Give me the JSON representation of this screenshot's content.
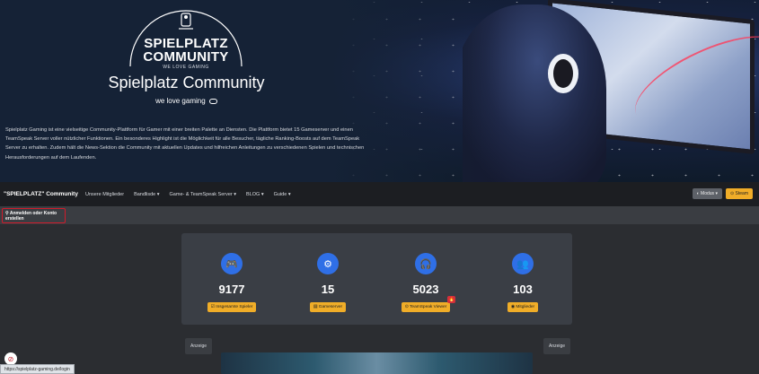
{
  "hero": {
    "logo_line1": "SPIELPLATZ",
    "logo_line2": "COMMUNITY",
    "logo_tagline": "WE LOVE GAMING",
    "title": "Spielplatz Community",
    "subtitle": "we love gaming",
    "description": "Spielplatz Gaming ist eine vielseitige Community-Plattform für Gamer mit einer breiten Palette an Diensten. Die Plattform bietet 15 Gameserver und einen TeamSpeak Server voller nützlicher Funktionen. Ein besonderes Highlight ist die Möglichkeit für alle Besucher, tägliche Ranking-Boosts auf dem TeamSpeak Server zu erhalten. Zudem hält die News-Sektion die Community mit aktuellen Updates und hilfreichen Anleitungen zu verschiedenen Spielen und technischen Herausforderungen auf dem Laufenden."
  },
  "navbar": {
    "brand": "\"SPIELPLATZ\" Community",
    "items": [
      "Unsere Mitglieder",
      "Bandlisde ▾",
      "Game- & TeamSpeak Server ▾",
      "BLOG ▾",
      "Guide ▾"
    ],
    "mode_label": "◐ Modus ▾",
    "steam_label": "⊙ Steam"
  },
  "subbar": {
    "login_label": "⚲ Anmelden oder Konto erstellen"
  },
  "stats": [
    {
      "icon": "gamepad-icon",
      "glyph": "🎮",
      "value": "9177",
      "label": "☑ Insgesamte Spieler"
    },
    {
      "icon": "server-icon",
      "glyph": "⚙",
      "value": "15",
      "label": "▤ Gameserver"
    },
    {
      "icon": "headset-icon",
      "glyph": "🎧",
      "value": "5023",
      "label": "⊙ TeamSpeak Viewer",
      "badge": "🔥"
    },
    {
      "icon": "users-icon",
      "glyph": "👥",
      "value": "103",
      "label": "◉ Mitglieder"
    }
  ],
  "ads": {
    "left": "Anzeige",
    "right": "Anzeige"
  },
  "status_url": "https://spielplatz-gaming.de/login",
  "colors": {
    "accent": "#f0ad28",
    "icon_blue": "#2f6fe6",
    "highlight_red": "#d11b2b"
  }
}
